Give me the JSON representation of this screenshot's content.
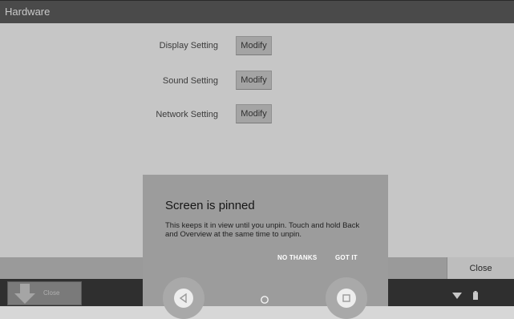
{
  "window": {
    "title": "Hardware"
  },
  "settings": [
    {
      "label": "Display Setting",
      "button": "Modify"
    },
    {
      "label": "Sound Setting",
      "button": "Modify"
    },
    {
      "label": "Network Setting",
      "button": "Modify"
    }
  ],
  "bottom_bar": {
    "close_label": "Close"
  },
  "taskbar": {
    "item_label": "Close"
  },
  "dialog": {
    "title": "Screen is pinned",
    "body": "This keeps it in view until you unpin. Touch and hold Back and Overview at the same time to unpin.",
    "negative": "NO THANKS",
    "positive": "GOT IT"
  },
  "navigation": {
    "back_icon": "back-triangle-icon",
    "home_icon": "home-circle-icon",
    "overview_icon": "overview-square-icon"
  },
  "status": {
    "icons": [
      "wifi-icon",
      "battery-icon"
    ]
  }
}
